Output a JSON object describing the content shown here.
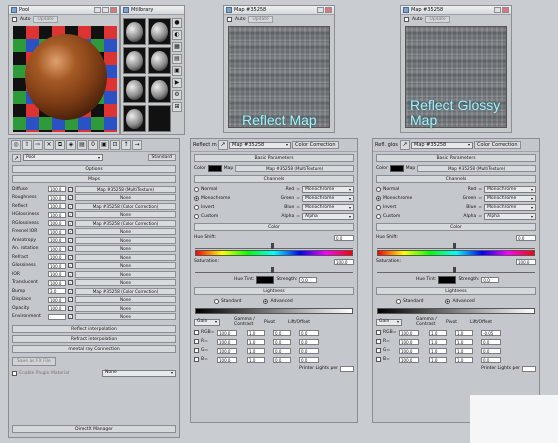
{
  "colors": {
    "overlay_text": "#a8f0f5",
    "material_ball": "#8b4a1c"
  },
  "mat_editor": {
    "title": "Pool",
    "auto_label": "Auto",
    "update_label": "Update"
  },
  "slate": {
    "title": "Mtllbrary"
  },
  "mapwin1": {
    "title": "Map #35258",
    "auto_label": "Auto",
    "update_label": "Update"
  },
  "mapwin2": {
    "title": "Map #35258",
    "auto_label": "Auto",
    "update_label": "Update"
  },
  "overlays": {
    "reflect_map": "Reflect Map",
    "reflect_glossy_line1": "Reflect Glossy",
    "reflect_glossy_line2": "Map"
  },
  "left_panel": {
    "material_name": "Pool",
    "material_type": "Standard",
    "rollout_options": "Options",
    "rollout_maps": "Maps",
    "maps": [
      {
        "label": "Diffuse",
        "value": "100.0",
        "checked": true,
        "map": "Map #35258 (MultiTexture)"
      },
      {
        "label": "Roughness",
        "value": "100.0",
        "checked": true,
        "map": "None"
      },
      {
        "label": "Reflect",
        "value": "100.0",
        "checked": true,
        "map": "Map #35258 (Color Correction)"
      },
      {
        "label": "HGlossiness",
        "value": "100.0",
        "checked": true,
        "map": "None"
      },
      {
        "label": "RGlossiness",
        "value": "100.0",
        "checked": true,
        "map": "Map #35258 (Color Correction)"
      },
      {
        "label": "Fresnel IOR",
        "value": "100.0",
        "checked": true,
        "map": "None"
      },
      {
        "label": "Anisotropy",
        "value": "100.0",
        "checked": true,
        "map": "None"
      },
      {
        "label": "An. rotation",
        "value": "100.0",
        "checked": true,
        "map": "None"
      },
      {
        "label": "Refract",
        "value": "100.0",
        "checked": true,
        "map": "None"
      },
      {
        "label": "Glossiness",
        "value": "100.0",
        "checked": true,
        "map": "None"
      },
      {
        "label": "IOR",
        "value": "100.0",
        "checked": true,
        "map": "None"
      },
      {
        "label": "Translucent",
        "value": "100.0",
        "checked": true,
        "map": "None"
      },
      {
        "label": "Bump",
        "value": "3.0",
        "checked": true,
        "map": "Map #35258 (Color Correction)"
      },
      {
        "label": "Displace",
        "value": "100.0",
        "checked": true,
        "map": "None"
      },
      {
        "label": "Opacity",
        "value": "100.0",
        "checked": true,
        "map": "None"
      },
      {
        "label": "Environment",
        "value": "",
        "checked": true,
        "map": "None"
      }
    ],
    "rollout_reflect_interp": "Reflect interpolation",
    "rollout_refract_interp": "Refract interpolation",
    "rollout_mental_ray": "mental ray Connection",
    "rollout_direct_memory": "DirectX Manager",
    "save_fx_file": "Save as FX File",
    "enable_plugin": "Enable Plugin Material",
    "plugin_value": "None"
  },
  "cc_panel_1": {
    "map_name": "Map #35258",
    "type": "Color Correction",
    "left_label": "Reflect mapi",
    "basic_params": "Basic Parameters",
    "color_label": "Color",
    "map_label": "Map",
    "map_value": "Map #35258 (MultiTexture)",
    "channels_title": "Channels",
    "channels": [
      {
        "radio": "Normal",
        "on": false,
        "ch": "Red",
        "val": "Monochrome"
      },
      {
        "radio": "Monochrome",
        "on": true,
        "ch": "Green",
        "val": "Monochrome"
      },
      {
        "radio": "Invert",
        "on": false,
        "ch": "Blue",
        "val": "Monochrome"
      },
      {
        "radio": "Custom",
        "on": false,
        "ch": "Alpha",
        "val": "Alpha"
      }
    ],
    "color_title": "Color",
    "hue_shift": "Hue Shift:",
    "hue_value": "0.0",
    "saturation": "Saturation:",
    "sat_value": "100.0",
    "hue_tint": "Hue Tint:",
    "strength": "Strength:",
    "strength_value": "0.0",
    "lightness_title": "Lightness",
    "standard": "Standard",
    "advanced": "Advanced",
    "adv_on": true,
    "mode_value": "Gain",
    "col_headers": [
      "Gamma / Contrast",
      "Pivot",
      "Lift/Offset"
    ],
    "rows": [
      {
        "label": "RGB=",
        "a": "100.0",
        "b": "1.0",
        "c": "0.0",
        "d": "0.0"
      },
      {
        "label": "R=",
        "a": "100.0",
        "b": "1.0",
        "c": "0.0",
        "d": "0.0"
      },
      {
        "label": "G=",
        "a": "100.0",
        "b": "1.0",
        "c": "0.0",
        "d": "0.0"
      },
      {
        "label": "B=",
        "a": "100.0",
        "b": "1.0",
        "c": "0.0",
        "d": "0.0"
      }
    ],
    "printer_lights": "Printer Lights per"
  },
  "cc_panel_2": {
    "map_name": "Map #35258",
    "type": "Color Correction",
    "left_label": "Refl. glos",
    "basic_params": "Basic Parameters",
    "color_label": "Color",
    "map_label": "Map",
    "map_value": "Map #35258 (MultiTexture)",
    "channels_title": "Channels",
    "channels": [
      {
        "radio": "Normal",
        "on": false,
        "ch": "Red",
        "val": "Monochrome"
      },
      {
        "radio": "Monochrome",
        "on": true,
        "ch": "Green",
        "val": "Monochrome"
      },
      {
        "radio": "Invert",
        "on": false,
        "ch": "Blue",
        "val": "Monochrome"
      },
      {
        "radio": "Custom",
        "on": false,
        "ch": "Alpha",
        "val": "Alpha"
      }
    ],
    "color_title": "Color",
    "hue_shift": "Hue Shift:",
    "hue_value": "0.0",
    "saturation": "Saturation:",
    "sat_value": "100.0",
    "hue_tint": "Hue Tint:",
    "strength": "Strength:",
    "strength_value": "0.0",
    "lightness_title": "Lightness",
    "standard": "Standard",
    "advanced": "Advanced",
    "adv_on": true,
    "mode_value": "Gain",
    "col_headers": [
      "Gamma / Contrast",
      "Pivot",
      "Lift/Offset"
    ],
    "rows": [
      {
        "label": "RGB=",
        "a": "100.0",
        "b": "1.0",
        "c": "1.0",
        "d": "-0.05"
      },
      {
        "label": "R=",
        "a": "100.0",
        "b": "1.0",
        "c": "1.0",
        "d": "0.0"
      },
      {
        "label": "G=",
        "a": "100.0",
        "b": "1.0",
        "c": "1.0",
        "d": "0.0"
      },
      {
        "label": "B=",
        "a": "100.0",
        "b": "1.0",
        "c": "1.0",
        "d": "0.0"
      }
    ],
    "printer_lights": "Printer Lights per"
  }
}
